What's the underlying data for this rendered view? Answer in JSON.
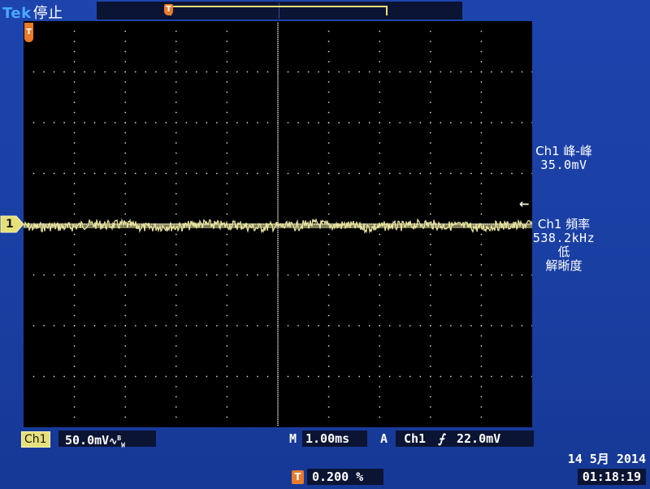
{
  "header": {
    "brand": "Tek",
    "acquisition_state": "停止",
    "trigger_position_marker": "T"
  },
  "channel": {
    "marker_label": "1",
    "name": "Ch1",
    "scale": "50.0mV",
    "bandwidth_icon": "bandwidth-limit-icon",
    "trace_color": "#e8e3a0"
  },
  "timebase": {
    "label": "M",
    "scale": "1.00ms"
  },
  "trigger": {
    "mode_label": "A",
    "source": "Ch1",
    "slope_icon": "rising-edge-icon",
    "level": "22.0mV",
    "offset_badge": "T",
    "offset": "0.200 %"
  },
  "measurements": [
    {
      "title": "Ch1 峰-峰",
      "value": "35.0mV"
    },
    {
      "title": "Ch1 頻率",
      "value": "538.2kHz",
      "note": "低",
      "note2": "解晰度"
    }
  ],
  "datetime": {
    "date": "14 5月  2014",
    "time": "01:18:19"
  },
  "colors": {
    "background": "#1b3fa4",
    "screen": "#000000",
    "grid": "#d0d0d0",
    "trace": "#e8e3a0",
    "trigger_marker": "#e87a2a",
    "brand": "#4aa8ff"
  }
}
